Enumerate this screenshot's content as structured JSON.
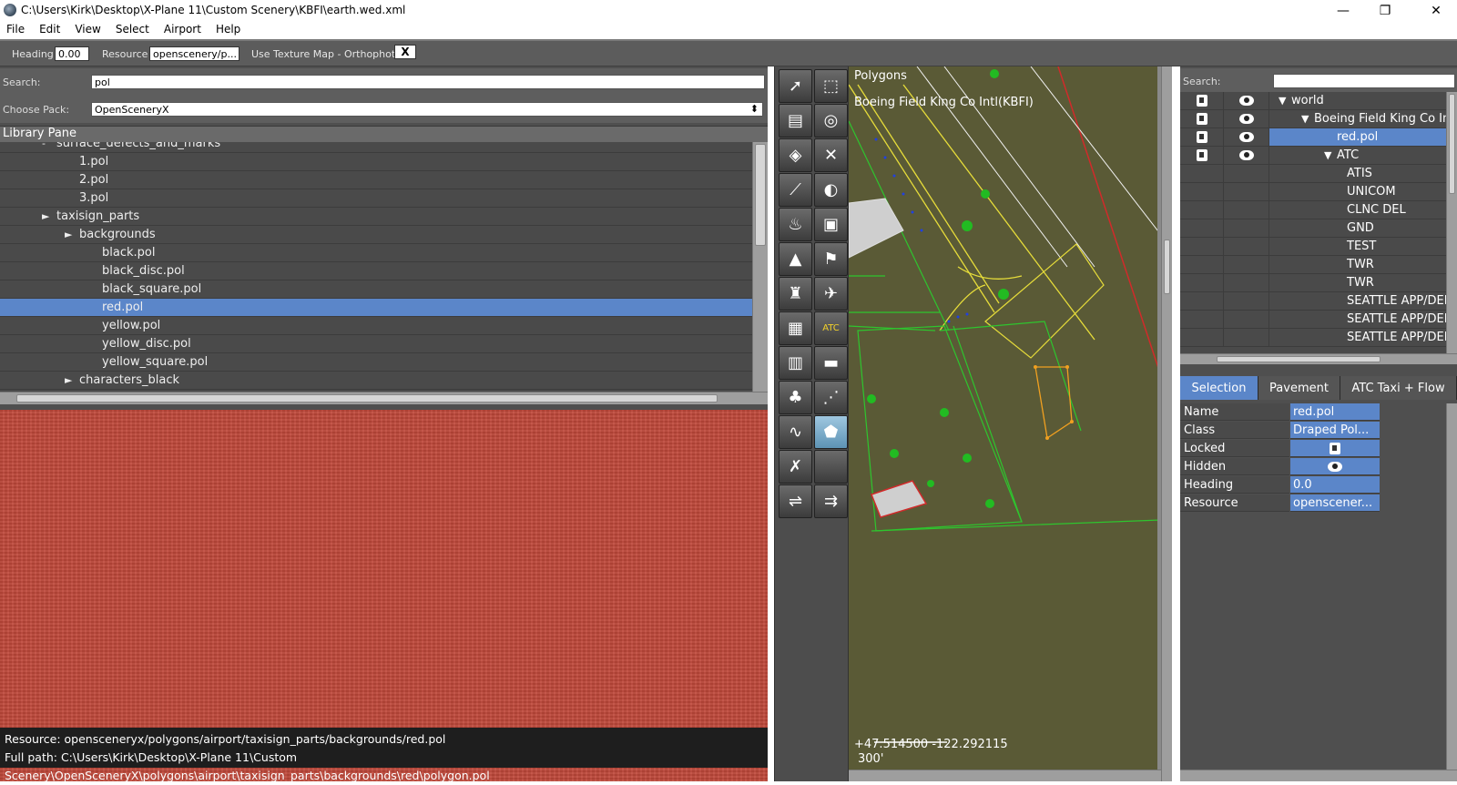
{
  "window": {
    "title": "C:\\Users\\Kirk\\Desktop\\X-Plane 11\\Custom Scenery\\KBFI\\earth.wed.xml",
    "minimize": "—",
    "maximize": "❐",
    "close": "✕"
  },
  "menu": [
    "File",
    "Edit",
    "View",
    "Select",
    "Airport",
    "Help"
  ],
  "toolbar": {
    "heading_label": "Heading",
    "heading_value": "0.00",
    "resource_label": "Resource",
    "resource_value": "openscenery/p...",
    "texture_label": "Use Texture Map - Orthophoto",
    "texture_button": "X"
  },
  "library": {
    "search_label": "Search:",
    "search_value": "pol",
    "pack_label": "Choose Pack:",
    "pack_value": "OpenSceneryX",
    "pack_arrow": "⬍",
    "header": "Library Pane",
    "rows": [
      {
        "label": "surface_defects_and_marks",
        "indent": 2,
        "arrow": "-"
      },
      {
        "label": "1.pol",
        "indent": 3,
        "arrow": ""
      },
      {
        "label": "2.pol",
        "indent": 3,
        "arrow": ""
      },
      {
        "label": "3.pol",
        "indent": 3,
        "arrow": ""
      },
      {
        "label": "taxisign_parts",
        "indent": 2,
        "arrow": "►"
      },
      {
        "label": "backgrounds",
        "indent": 3,
        "arrow": "►"
      },
      {
        "label": "black.pol",
        "indent": 4,
        "arrow": ""
      },
      {
        "label": "black_disc.pol",
        "indent": 4,
        "arrow": ""
      },
      {
        "label": "black_square.pol",
        "indent": 4,
        "arrow": ""
      },
      {
        "label": "red.pol",
        "indent": 4,
        "arrow": "",
        "selected": true
      },
      {
        "label": "yellow.pol",
        "indent": 4,
        "arrow": ""
      },
      {
        "label": "yellow_disc.pol",
        "indent": 4,
        "arrow": ""
      },
      {
        "label": "yellow_square.pol",
        "indent": 4,
        "arrow": ""
      },
      {
        "label": "characters_black",
        "indent": 3,
        "arrow": "►"
      }
    ]
  },
  "preview": {
    "resource": "Resource: opensceneryx/polygons/airport/taxisign_parts/backgrounds/red.pol",
    "full_path": "Full path: C:\\Users\\Kirk\\Desktop\\X-Plane 11\\Custom Scenery\\OpenSceneryX\\polygons\\airport\\taxisign_parts\\backgrounds\\red\\polygon.pol"
  },
  "tools": [
    {
      "icon": "arrow-select-icon",
      "glyph": "➚"
    },
    {
      "icon": "marquee-icon",
      "glyph": "⬚"
    },
    {
      "icon": "runway-icon",
      "glyph": "▤"
    },
    {
      "icon": "helipad-icon",
      "glyph": "◎"
    },
    {
      "icon": "taxiway-icon",
      "glyph": "◈"
    },
    {
      "icon": "taxi-route-icon",
      "glyph": "✕"
    },
    {
      "icon": "line-marking-icon",
      "glyph": "⟋"
    },
    {
      "icon": "boundary-icon",
      "glyph": "◐"
    },
    {
      "icon": "light-icon",
      "glyph": "♨"
    },
    {
      "icon": "sign-icon",
      "glyph": "▣"
    },
    {
      "icon": "beacon-icon",
      "glyph": "▲"
    },
    {
      "icon": "windsock-icon",
      "glyph": "⚑"
    },
    {
      "icon": "tower-icon",
      "glyph": "♜"
    },
    {
      "icon": "ramp-start-icon",
      "glyph": "✈"
    },
    {
      "icon": "forest-icon",
      "glyph": "▦"
    },
    {
      "icon": "atc-icon",
      "glyph": "ATC"
    },
    {
      "icon": "facade-icon",
      "glyph": "▥"
    },
    {
      "icon": "object-icon",
      "glyph": "▬"
    },
    {
      "icon": "tree-icon",
      "glyph": "♣"
    },
    {
      "icon": "string-icon",
      "glyph": "⋰"
    },
    {
      "icon": "line-icon",
      "glyph": "∿"
    },
    {
      "icon": "polygon-icon",
      "glyph": "⬟",
      "selected": true
    },
    {
      "icon": "exclusion-icon",
      "glyph": "✗"
    },
    {
      "icon": "blank-tool-icon",
      "glyph": ""
    },
    {
      "icon": "road-icon",
      "glyph": "⇌"
    },
    {
      "icon": "truck-route-icon",
      "glyph": "⇉"
    }
  ],
  "map": {
    "layer": "Polygons",
    "airport": "Boeing Field King Co Intl(KBFI)",
    "coords": "+47.514500 -122.292115",
    "scale": "300'"
  },
  "hierarchy": {
    "search_label": "Search:",
    "rows": [
      {
        "label": "world",
        "indent": 0,
        "arrow": "▼",
        "lock": true,
        "eye": true
      },
      {
        "label": "Boeing Field King Co Intl",
        "indent": 1,
        "arrow": "▼",
        "lock": true,
        "eye": true
      },
      {
        "label": "red.pol",
        "indent": 2,
        "arrow": "",
        "lock": true,
        "eye": true,
        "selected": true
      },
      {
        "label": "ATC",
        "indent": 2,
        "arrow": "▼",
        "lock": true,
        "eye": true
      },
      {
        "label": "ATIS",
        "indent": 3,
        "arrow": ""
      },
      {
        "label": "UNICOM",
        "indent": 3,
        "arrow": ""
      },
      {
        "label": "CLNC DEL",
        "indent": 3,
        "arrow": ""
      },
      {
        "label": "GND",
        "indent": 3,
        "arrow": ""
      },
      {
        "label": "TEST",
        "indent": 3,
        "arrow": ""
      },
      {
        "label": "TWR",
        "indent": 3,
        "arrow": ""
      },
      {
        "label": "TWR",
        "indent": 3,
        "arrow": ""
      },
      {
        "label": "SEATTLE APP/DEP",
        "indent": 3,
        "arrow": ""
      },
      {
        "label": "SEATTLE APP/DEP",
        "indent": 3,
        "arrow": ""
      },
      {
        "label": "SEATTLE APP/DEP",
        "indent": 3,
        "arrow": ""
      }
    ]
  },
  "tabs": [
    "Selection",
    "Pavement",
    "ATC Taxi + Flow"
  ],
  "properties": [
    {
      "key": "Name",
      "value": "red.pol"
    },
    {
      "key": "Class",
      "value": "Draped Pol..."
    },
    {
      "key": "Locked",
      "value": "",
      "icon": "lock-icon"
    },
    {
      "key": "Hidden",
      "value": "",
      "icon": "eye-icon"
    },
    {
      "key": "Heading",
      "value": "0.0"
    },
    {
      "key": "Resource",
      "value": "openscener..."
    }
  ],
  "colors": {
    "selection": "#5b86c9",
    "map_bg": "#5a5a36",
    "preview": "#c0483a",
    "green_line": "#2ec52e",
    "yellow_line": "#e6dc3a",
    "orange_poly": "#f0a020"
  }
}
